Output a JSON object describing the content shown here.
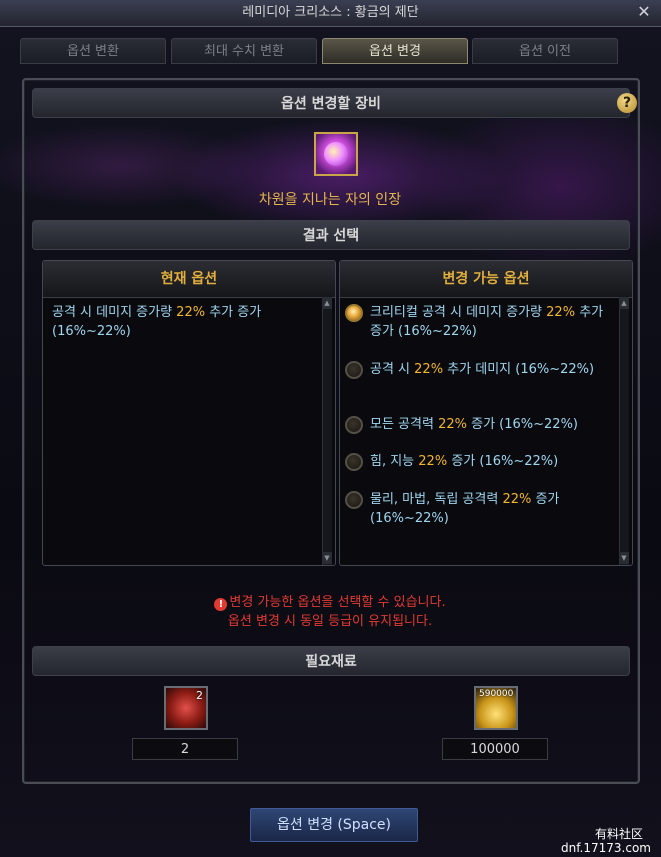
{
  "window": {
    "title": "레미디아 크리소스 : 황금의 제단",
    "close": "✕"
  },
  "tabs": [
    {
      "label": "옵션 변환",
      "active": false
    },
    {
      "label": "최대 수치 변환",
      "active": false
    },
    {
      "label": "옵션 변경",
      "active": true
    },
    {
      "label": "옵션 이전",
      "active": false
    }
  ],
  "equipment": {
    "header": "옵션 변경할 장비",
    "help": "?",
    "item_name": "차원을 지나는 자의 인장"
  },
  "result": {
    "header": "결과 선택"
  },
  "current": {
    "header": "현재 옵션",
    "text_pre": "공격 시 데미지 증가량 ",
    "hl": "22%",
    "text_post": " 추가 증가 (16%~22%)"
  },
  "changeable": {
    "header": "변경 가능 옵션",
    "options": [
      {
        "pre": "크리티컬 공격 시 데미지 증가량 ",
        "hl": "22%",
        "post": " 추가 증가 (16%~22%)",
        "checked": true
      },
      {
        "pre": "공격 시 ",
        "hl": "22%",
        "post": " 추가 데미지 (16%~22%)",
        "checked": false
      },
      {
        "pre": "모든 공격력 ",
        "hl": "22%",
        "post": " 증가 (16%~22%)",
        "checked": false
      },
      {
        "pre": "힘, 지능 ",
        "hl": "22%",
        "post": " 증가 (16%~22%)",
        "checked": false
      },
      {
        "pre": "물리, 마법, 독립 공격력 ",
        "hl": "22%",
        "post": " 증가 (16%~22%)",
        "checked": false
      }
    ]
  },
  "notice": {
    "icon": "!",
    "line1": "변경 가능한 옵션을 선택할 수 있습니다.",
    "line2": "옵션 변경 시 동일 등급이 유지됩니다."
  },
  "materials": {
    "header": "필요재료",
    "items": [
      {
        "icon": "red-crystal-icon",
        "count_badge": "2",
        "qty": "2"
      },
      {
        "icon": "gold-coins-icon",
        "count_badge": "590000",
        "qty": "100000"
      }
    ]
  },
  "action": {
    "label": "옵션 변경 (Space)"
  },
  "watermark": {
    "line1": "有料社区",
    "line2": "dnf.17173.com"
  },
  "colors": {
    "highlight": "#f2b62e",
    "option_text": "#9fd6f0",
    "notice": "#e23a32",
    "header_gold": "#e2ae3c"
  }
}
